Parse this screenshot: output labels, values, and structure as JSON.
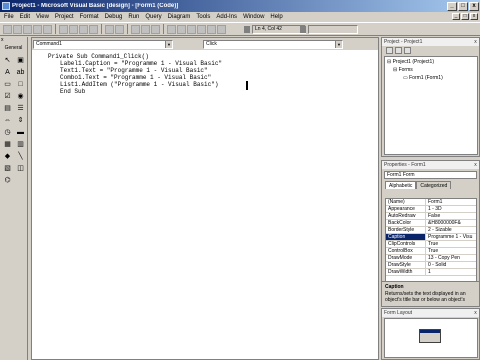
{
  "window": {
    "title": "Project1 - Microsoft Visual Basic [design] - [Form1 (Code)]",
    "controls": [
      "_",
      "□",
      "x"
    ]
  },
  "menu": {
    "items": [
      "File",
      "Edit",
      "View",
      "Project",
      "Format",
      "Debug",
      "Run",
      "Query",
      "Diagram",
      "Tools",
      "Add-Ins",
      "Window",
      "Help"
    ],
    "mdi_controls": [
      "_",
      "□",
      "x"
    ]
  },
  "toolbar": {
    "position": "Ln 4, Col 42"
  },
  "toolbox": {
    "title": "x",
    "header": "General",
    "tools": [
      "pointer-icon",
      "picture-icon",
      "label-icon",
      "textbox-icon",
      "frame-icon",
      "button-icon",
      "checkbox-icon",
      "option-icon",
      "combobox-icon",
      "listbox-icon",
      "hscroll-icon",
      "vscroll-icon",
      "timer-icon",
      "drive-icon",
      "dir-icon",
      "file-icon",
      "shape-icon",
      "line-icon",
      "image-icon",
      "data-icon",
      "ole-icon"
    ]
  },
  "code": {
    "object_combo": "Command1",
    "proc_combo": "Click",
    "lines": [
      "Private Sub Command1_Click()",
      "Label1.Caption = \"Programme 1 - Visual Basic\"",
      "Text1.Text = \"Programme 1 - Visual Basic\"",
      "Combo1.Text = \"Programme 1 - Visual Basic\"",
      "List1.AddItem (\"Programme 1 - Visual Basic\")",
      "End Sub"
    ]
  },
  "project": {
    "title": "Project - Project1",
    "tree": [
      "Project1 (Project1)",
      "Forms",
      "Form1 (Form1)"
    ]
  },
  "properties": {
    "title": "Properties - Form1",
    "object": "Form1 Form",
    "tabs": [
      "Alphabetic",
      "Categorized"
    ],
    "rows": [
      {
        "name": "(Name)",
        "value": "Form1"
      },
      {
        "name": "Appearance",
        "value": "1 - 3D"
      },
      {
        "name": "AutoRedraw",
        "value": "False"
      },
      {
        "name": "BackColor",
        "value": "&H8000000F&"
      },
      {
        "name": "BorderStyle",
        "value": "2 - Sizable"
      },
      {
        "name": "Caption",
        "value": "Programme 1 - Visu"
      },
      {
        "name": "ClipControls",
        "value": "True"
      },
      {
        "name": "ControlBox",
        "value": "True"
      },
      {
        "name": "DrawMode",
        "value": "13 - Copy Pen"
      },
      {
        "name": "DrawStyle",
        "value": "0 - Solid"
      },
      {
        "name": "DrawWidth",
        "value": "1"
      }
    ],
    "selected": "Caption"
  },
  "description": {
    "title": "Caption",
    "text": "Returns/sets the text displayed in an object's title bar or below an object's"
  },
  "layout": {
    "title": "Form Layout"
  }
}
